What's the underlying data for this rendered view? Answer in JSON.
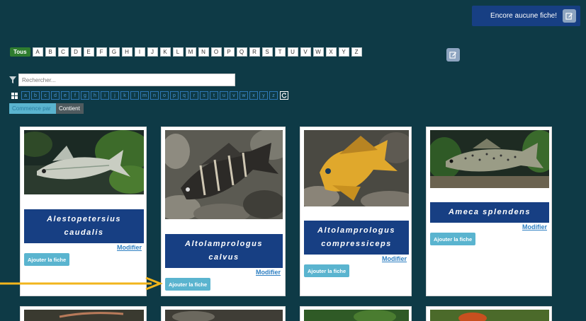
{
  "banner": {
    "text": "Encore aucune fiche!",
    "icon": "edit-icon"
  },
  "alphabet": {
    "all_label": "Tous",
    "letters": [
      "A",
      "B",
      "C",
      "D",
      "E",
      "F",
      "G",
      "H",
      "I",
      "J",
      "K",
      "L",
      "M",
      "N",
      "O",
      "P",
      "Q",
      "R",
      "S",
      "T",
      "U",
      "V",
      "W",
      "X",
      "Y",
      "Z"
    ]
  },
  "search": {
    "placeholder": "Rechercher..."
  },
  "small_letters": [
    "a",
    "b",
    "c",
    "d",
    "e",
    "f",
    "g",
    "h",
    "i",
    "j",
    "k",
    "l",
    "m",
    "n",
    "o",
    "p",
    "q",
    "r",
    "s",
    "t",
    "u",
    "v",
    "w",
    "x",
    "y",
    "z"
  ],
  "mode": {
    "starts_with": "Commence par",
    "contains": "Contient"
  },
  "cards": [
    {
      "name": "Alestopetersius caudalis",
      "modify": "Modifier",
      "add": "Ajouter la fiche"
    },
    {
      "name": "Altolamprologus calvus",
      "modify": "Modifier",
      "add": "Ajouter la fiche"
    },
    {
      "name": "Altolamprologus compressiceps",
      "modify": "Modifier",
      "add": "Ajouter la fiche"
    },
    {
      "name": "Ameca splendens",
      "modify": "Modifier",
      "add": "Ajouter la fiche"
    }
  ],
  "colors": {
    "background": "#0e3a46",
    "title_bar": "#173f83",
    "button": "#5ab4cf",
    "arrow": "#f2b51c",
    "tous": "#2f7d2f"
  }
}
